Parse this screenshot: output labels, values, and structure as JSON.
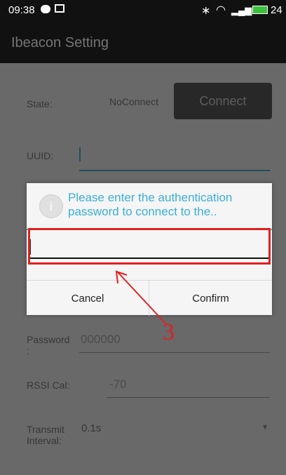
{
  "status_bar": {
    "time": "09:38",
    "battery": "24"
  },
  "app": {
    "title": "Ibeacon Setting"
  },
  "form": {
    "state_label": "State:",
    "state_value": "NoConnect",
    "connect_button": "Connect",
    "uuid_label": "UUID:",
    "password_label": "Password\n:",
    "password_placeholder": "000000",
    "rssi_label": "RSSI Cal:",
    "rssi_placeholder": "-70",
    "transmit_label": "Transmit\nInterval:",
    "transmit_value": "0.1s"
  },
  "dialog": {
    "title": "Please enter the authentication password to connect to the..",
    "input_value": "",
    "cancel_label": "Cancel",
    "confirm_label": "Confirm"
  },
  "annotation": {
    "label": "3",
    "color": "#e02020"
  }
}
